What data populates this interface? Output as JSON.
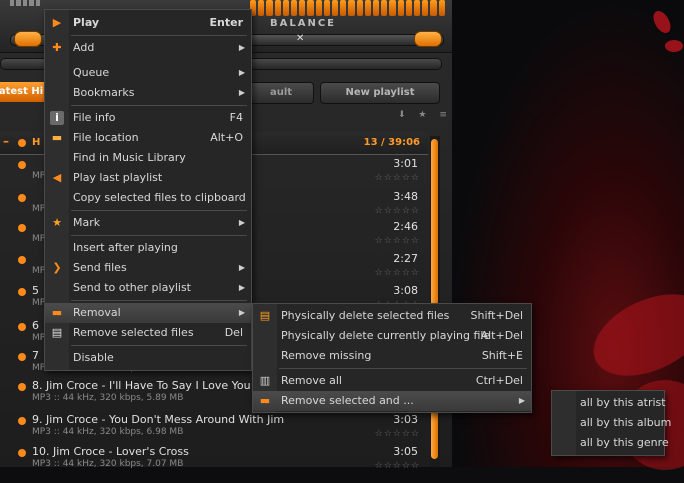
{
  "player": {
    "balance_label": "BALANCE",
    "tabs": {
      "active": "atest Hi",
      "mid": "ault",
      "new": "New playlist"
    },
    "list_icons": "⬇ ★ ≡",
    "group": {
      "title": "H",
      "total": "13 / 39:06"
    },
    "tracks": [
      {
        "title": "",
        "meta": "MP",
        "time": "3:01"
      },
      {
        "title": "",
        "meta": "MP",
        "time": "3:48"
      },
      {
        "title": "",
        "meta": "MP",
        "time": "2:46"
      },
      {
        "title": "",
        "meta": "MP",
        "time": "2:27"
      },
      {
        "title": "5",
        "meta": "MP",
        "time": "3:08"
      },
      {
        "title": "6",
        "meta": "MP",
        "time": ""
      },
      {
        "title": "7",
        "meta": "MP3 :: 44 kHz, 320 kbps, 7.50 MB",
        "time": ""
      },
      {
        "title": "8. Jim Croce - I'll Have To Say I Love You In",
        "meta": "MP3 :: 44 kHz, 320 kbps, 5.89 MB",
        "time": ""
      },
      {
        "title": "9. Jim Croce - You Don't Mess Around With Jim",
        "meta": "MP3 :: 44 kHz, 320 kbps, 6.98 MB",
        "time": "3:03"
      },
      {
        "title": "10. Jim Croce - Lover's Cross",
        "meta": "MP3 :: 44 kHz, 320 kbps, 7.07 MB",
        "time": "3:05"
      }
    ]
  },
  "menu_main": [
    {
      "label": "Play",
      "shortcut": "Enter",
      "bold": true,
      "icon": "play-icon"
    },
    {
      "label": "Add",
      "submenu": true,
      "icon": "plus-icon"
    },
    {
      "label": "Queue",
      "submenu": true
    },
    {
      "label": "Bookmarks",
      "submenu": true
    },
    {
      "label": "File info",
      "shortcut": "F4",
      "icon": "info-icon"
    },
    {
      "label": "File location",
      "shortcut": "Alt+O",
      "icon": "folder-icon"
    },
    {
      "label": "Find in Music Library"
    },
    {
      "label": "Play last playlist",
      "icon": "back-arrow-icon"
    },
    {
      "label": "Copy selected files to clipboard"
    },
    {
      "label": "Mark",
      "submenu": true,
      "icon": "star-icon"
    },
    {
      "label": "Insert after playing"
    },
    {
      "label": "Send files",
      "submenu": true,
      "icon": "forward-arrow-icon"
    },
    {
      "label": "Send to other playlist",
      "submenu": true
    },
    {
      "label": "Removal",
      "submenu": true,
      "icon": "minus-icon"
    },
    {
      "label": "Remove selected files",
      "shortcut": "Del",
      "icon": "document-icon"
    },
    {
      "label": "Disable"
    }
  ],
  "menu_removal": [
    {
      "label": "Physically delete selected files",
      "shortcut": "Shift+Del",
      "icon": "delete-file-icon"
    },
    {
      "label": "Physically delete currently playing file",
      "shortcut": "Alt+Del"
    },
    {
      "label": "Remove missing",
      "shortcut": "Shift+E"
    },
    {
      "label": "Remove all",
      "shortcut": "Ctrl+Del",
      "icon": "trash-icon"
    },
    {
      "label": "Remove selected and ...",
      "submenu": true,
      "icon": "minus-icon"
    }
  ],
  "menu_remove_and": [
    {
      "label": "all by this atrist"
    },
    {
      "label": "all by this album"
    },
    {
      "label": "all by this genre"
    }
  ],
  "colors": {
    "accent": "#ff8a1a",
    "menu_bg": "#262626",
    "highlight": "#444444"
  }
}
